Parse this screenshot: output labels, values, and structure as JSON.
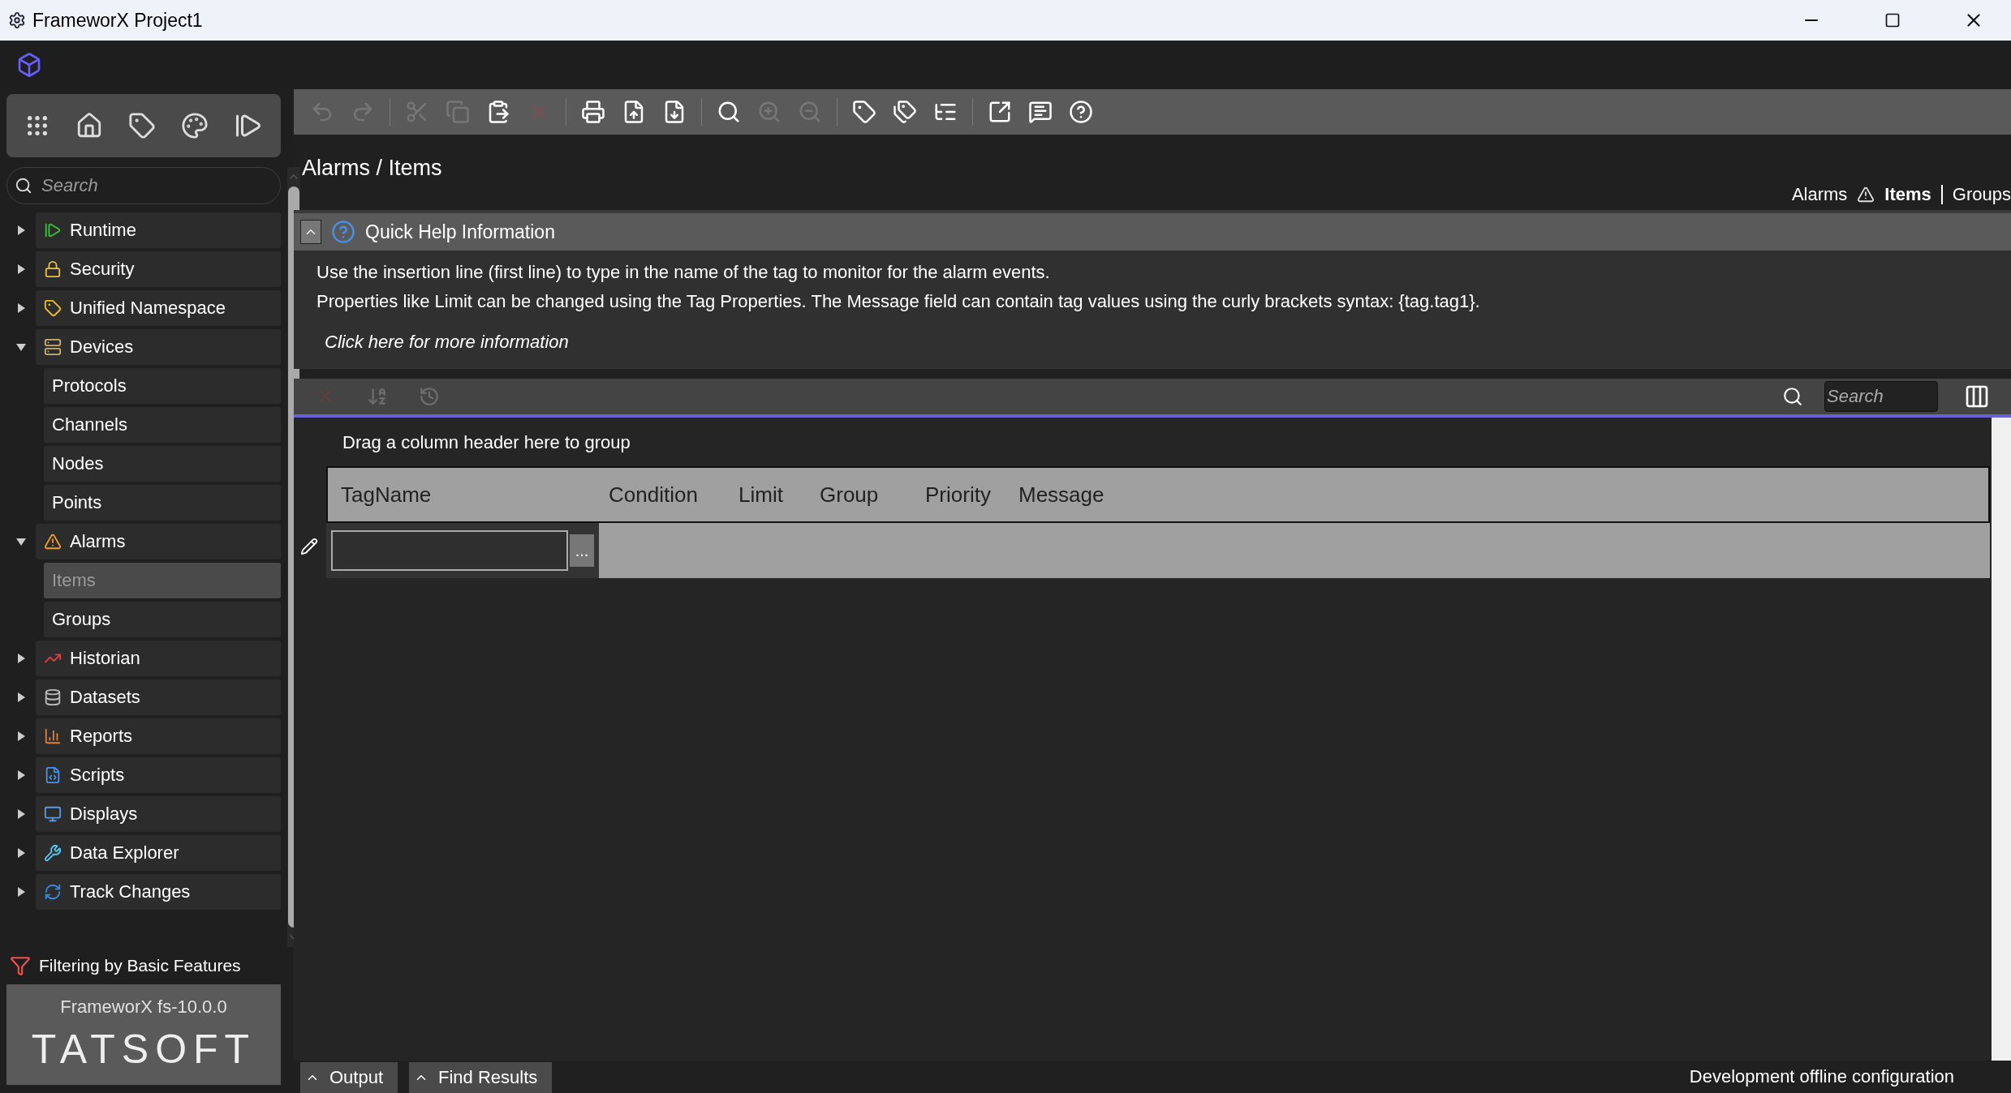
{
  "window": {
    "title": "FrameworX Project1"
  },
  "toolbar": [
    {
      "kind": "undo",
      "disabled": true
    },
    {
      "kind": "redo",
      "disabled": true
    },
    {
      "kind": "separator"
    },
    {
      "kind": "cut",
      "disabled": true
    },
    {
      "kind": "copy",
      "disabled": true
    },
    {
      "kind": "paste",
      "disabled": false
    },
    {
      "kind": "delete",
      "disabled": true
    },
    {
      "kind": "separator"
    },
    {
      "kind": "print",
      "disabled": false
    },
    {
      "kind": "export",
      "disabled": false
    },
    {
      "kind": "import",
      "disabled": false
    },
    {
      "kind": "separator"
    },
    {
      "kind": "find",
      "disabled": false
    },
    {
      "kind": "find-prev",
      "disabled": true
    },
    {
      "kind": "find-next",
      "disabled": true
    },
    {
      "kind": "separator"
    },
    {
      "kind": "new-tag",
      "disabled": false
    },
    {
      "kind": "tag-properties",
      "disabled": false
    },
    {
      "kind": "tree",
      "disabled": false
    },
    {
      "kind": "separator"
    },
    {
      "kind": "open-external",
      "disabled": false
    },
    {
      "kind": "comment",
      "disabled": false
    },
    {
      "kind": "help",
      "disabled": false
    }
  ],
  "sidebar": {
    "search": {
      "placeholder": "Search"
    },
    "items": [
      {
        "label": "Runtime",
        "kind": "runtime",
        "expanded": false,
        "selected": false
      },
      {
        "label": "Security",
        "kind": "security",
        "expanded": false,
        "selected": false
      },
      {
        "label": "Unified Namespace",
        "kind": "namespace",
        "expanded": false,
        "selected": false
      },
      {
        "label": "Devices",
        "kind": "devices",
        "expanded": true,
        "selected": false,
        "children": [
          {
            "label": "Protocols",
            "selected": false
          },
          {
            "label": "Channels",
            "selected": false
          },
          {
            "label": "Nodes",
            "selected": false
          },
          {
            "label": "Points",
            "selected": false
          }
        ]
      },
      {
        "label": "Alarms",
        "kind": "alarms",
        "expanded": true,
        "selected": false,
        "children": [
          {
            "label": "Items",
            "selected": true
          },
          {
            "label": "Groups",
            "selected": false
          }
        ]
      },
      {
        "label": "Historian",
        "kind": "historian",
        "expanded": false,
        "selected": false
      },
      {
        "label": "Datasets",
        "kind": "datasets",
        "expanded": false,
        "selected": false
      },
      {
        "label": "Reports",
        "kind": "reports",
        "expanded": false,
        "selected": false
      },
      {
        "label": "Scripts",
        "kind": "scripts",
        "expanded": false,
        "selected": false
      },
      {
        "label": "Displays",
        "kind": "displays",
        "expanded": false,
        "selected": false
      },
      {
        "label": "Data Explorer",
        "kind": "explorer",
        "expanded": false,
        "selected": false
      },
      {
        "label": "Track Changes",
        "kind": "changes",
        "expanded": false,
        "selected": false
      }
    ],
    "filter_note": "Filtering by Basic Features",
    "version": "FrameworX fs-10.0.0",
    "brand": "TATSOFT"
  },
  "breadcrumb": "Alarms / Items",
  "section_links": [
    {
      "label": "Alarms",
      "selected": false
    },
    {
      "label": "Items",
      "selected": true
    },
    {
      "label": "Groups",
      "selected": false
    }
  ],
  "quick_help": {
    "title": "Quick Help Information",
    "expanded": true,
    "lines": [
      "Use the insertion line (first line) to type in the name of the tag to monitor for the alarm events.",
      "Properties like Limit can be changed using the Tag Properties. The Message field can contain tag values using the curly brackets syntax: {tag.tag1}."
    ],
    "link": "Click here for more information"
  },
  "grid": {
    "search": {
      "placeholder": "Search"
    },
    "group_hint": "Drag a column header here to group",
    "columns": [
      "TagName",
      "Condition",
      "Limit",
      "Group",
      "Priority",
      "Message"
    ],
    "new_row_button": "..."
  },
  "bottom_tabs": [
    "Output",
    "Find Results"
  ],
  "status": "Development offline configuration"
}
